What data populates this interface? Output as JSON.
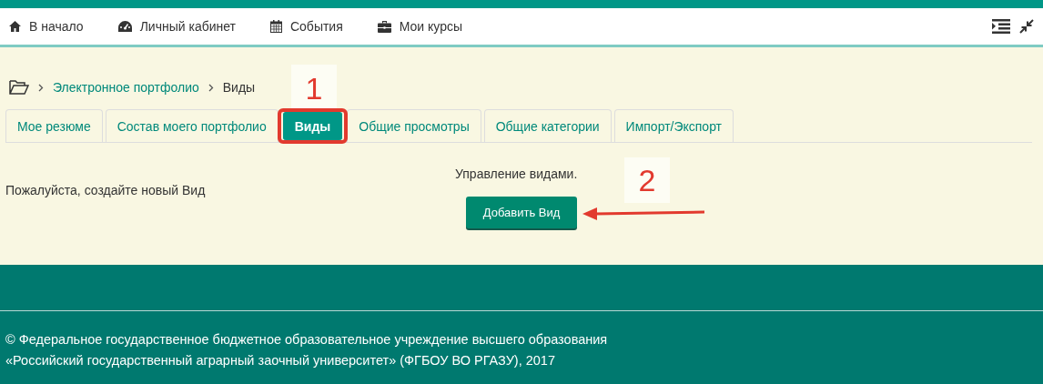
{
  "nav": {
    "items": [
      {
        "kind": "home",
        "label": "В начало"
      },
      {
        "kind": "dashboard",
        "label": "Личный кабинет"
      },
      {
        "kind": "calendar",
        "label": "События"
      },
      {
        "kind": "briefcase",
        "label": "Мои курсы"
      }
    ]
  },
  "breadcrumb": {
    "items": [
      {
        "label": "Электронное портфолио",
        "link": true
      },
      {
        "label": "Виды",
        "link": false
      }
    ]
  },
  "tabs": [
    {
      "label": "Мое резюме",
      "selected": false
    },
    {
      "label": "Состав моего портфолио",
      "selected": false
    },
    {
      "label": "Виды",
      "selected": true
    },
    {
      "label": "Общие просмотры",
      "selected": false
    },
    {
      "label": "Общие категории",
      "selected": false
    },
    {
      "label": "Импорт/Экспорт",
      "selected": false
    }
  ],
  "message": "Пожалуйста, создайте новый Вид",
  "manage_label": "Управление видами.",
  "add_button": "Добавить Вид",
  "annotations": [
    {
      "label": "1"
    },
    {
      "label": "2"
    }
  ],
  "footer": {
    "lines": [
      "© Федеральное государственное бюджетное образовательное учреждение высшего образования",
      "«Российский государственный аграрный заочный университет» (ФГБОУ ВО РГАЗУ), 2017"
    ]
  }
}
